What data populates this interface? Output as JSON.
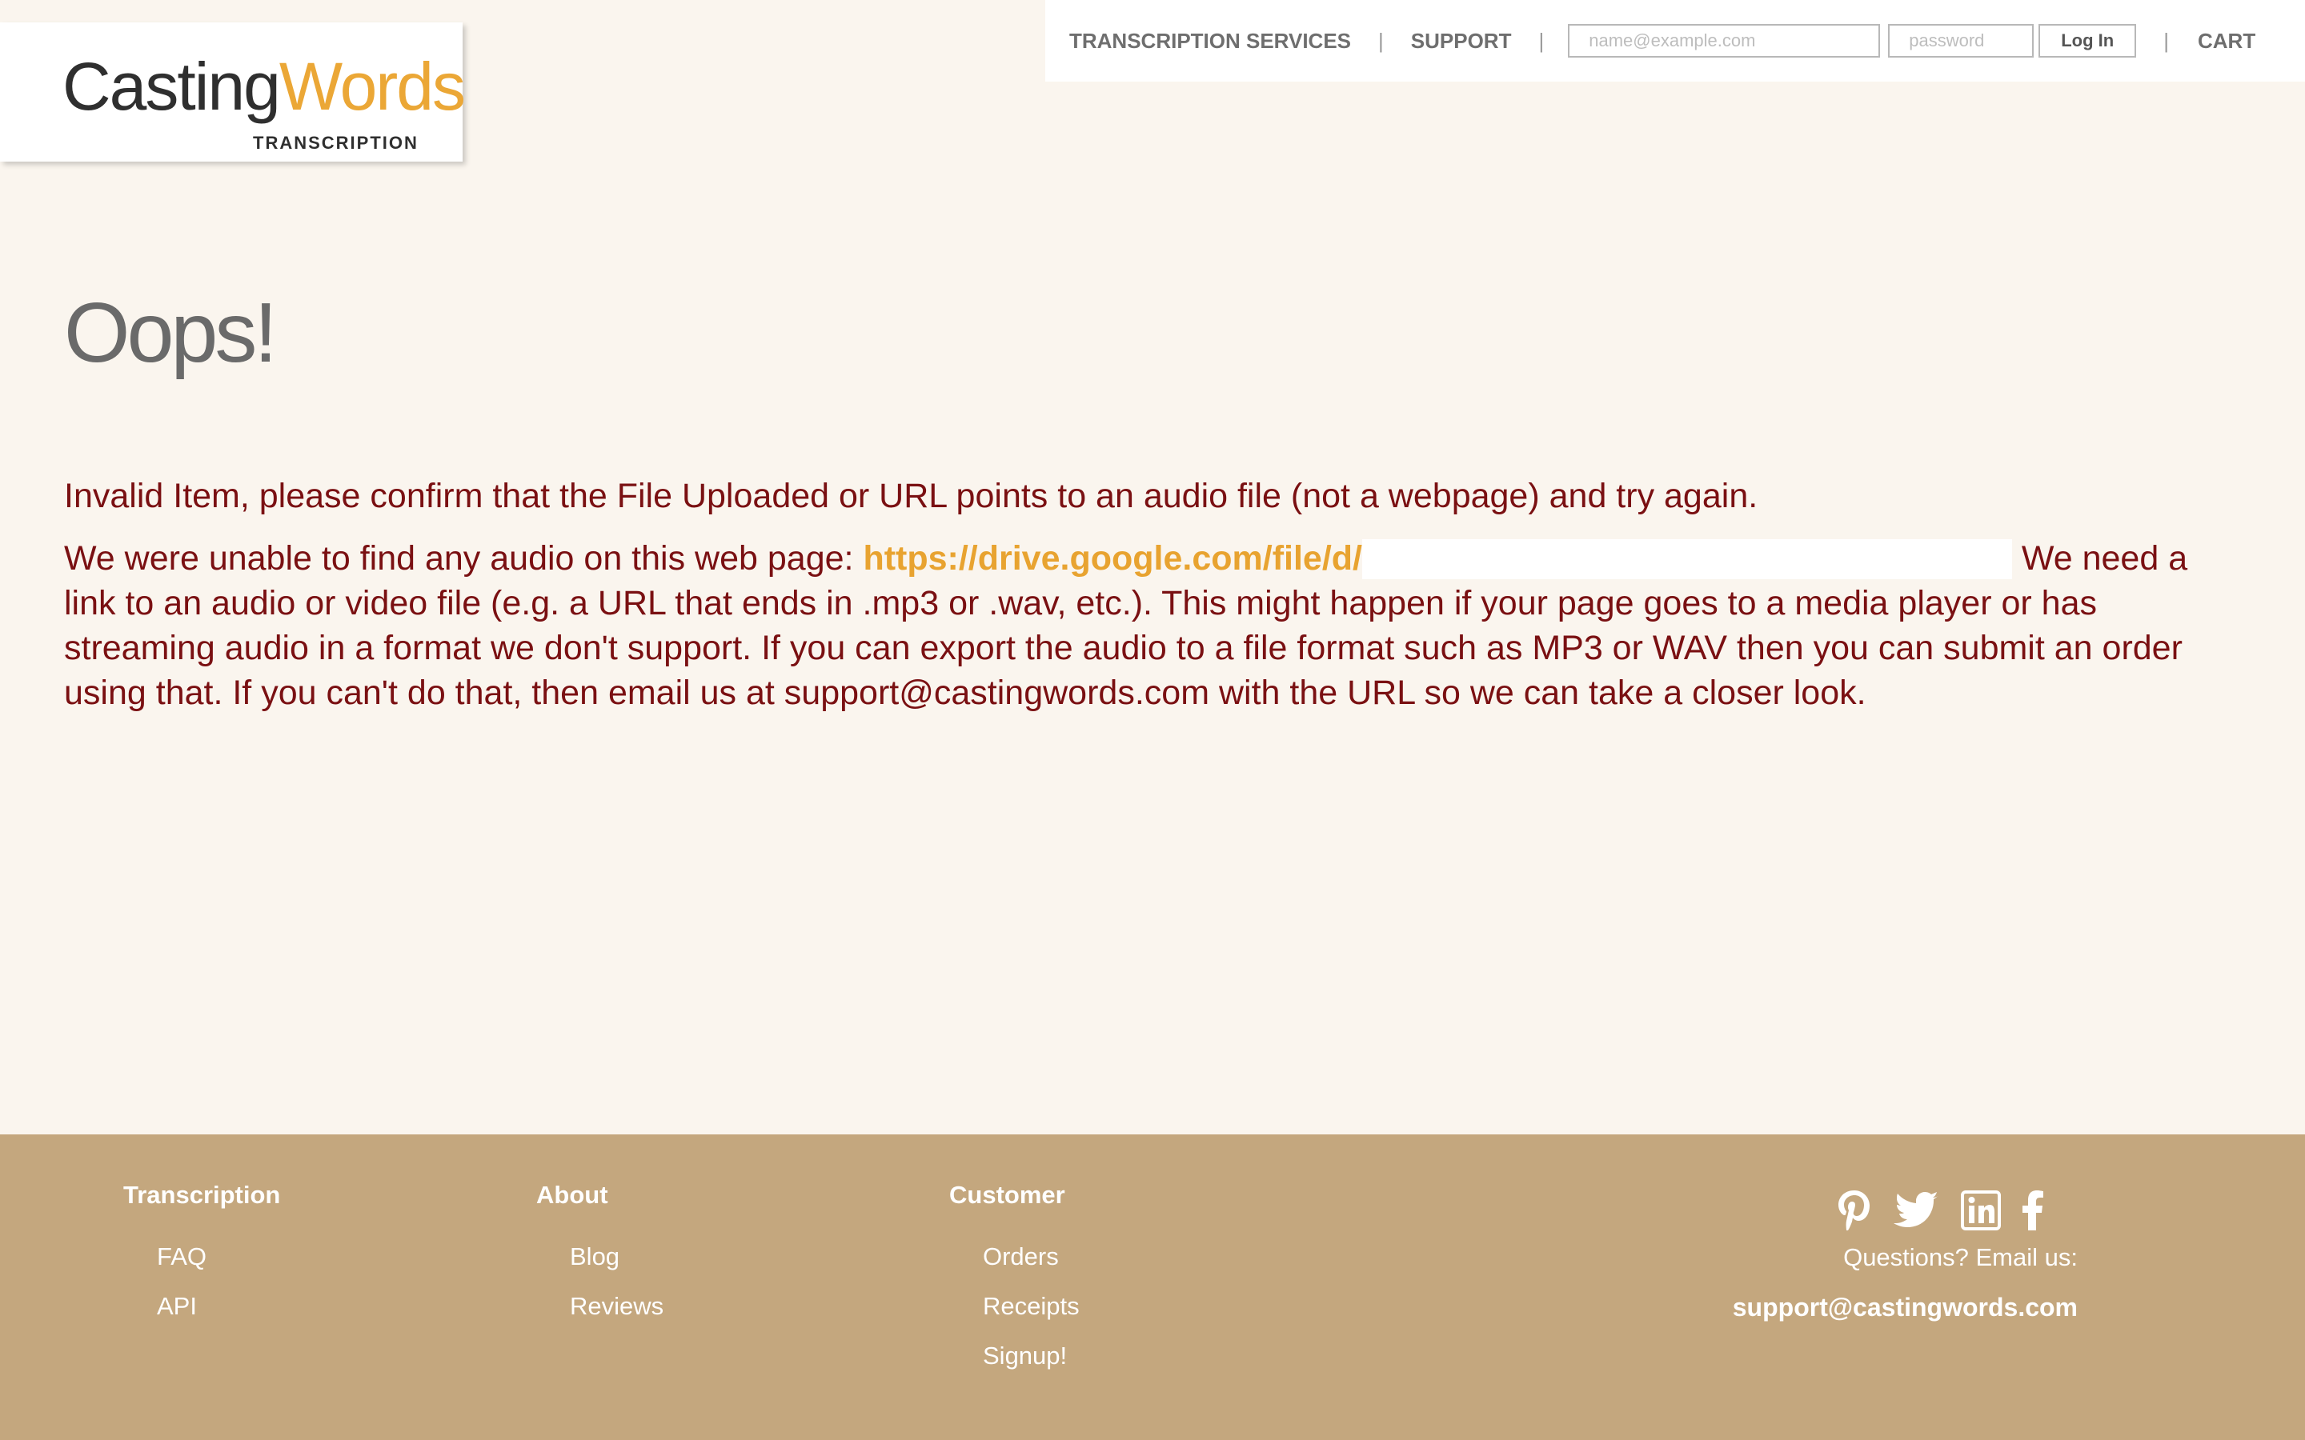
{
  "logo": {
    "part1": "Casting",
    "part2": "Words",
    "tagline": "TRANSCRIPTION",
    "colors": {
      "dark": "#2f2f2f",
      "accent": "#eba736"
    }
  },
  "nav": {
    "services": "TRANSCRIPTION SERVICES",
    "support": "SUPPORT",
    "separator": "|",
    "email_placeholder": "name@example.com",
    "password_placeholder": "password",
    "login_label": "Log In",
    "cart": "CART"
  },
  "main": {
    "heading": "Oops!",
    "message1": "Invalid Item, please confirm that the File Uploaded or URL points to an audio file (not a webpage) and try again.",
    "message2_before": "We were unable to find any audio on this web page: ",
    "url_visible": "https://drive.google.com/file/d/",
    "message2_after": " We need a link to an audio or video file (e.g. a URL that ends in .mp3 or .wav, etc.). This might happen if your page goes to a media player or has streaming audio in a format we don't support. If you can export the audio to a file format such as MP3 or WAV then you can submit an order using that. If you can't do that, then email us at support@castingwords.com with the URL so we can take a closer look.",
    "colors": {
      "message": "#7a1012",
      "link": "#e8a330",
      "heading": "#6a6a6a"
    }
  },
  "footer": {
    "columns": [
      {
        "heading": "Transcription",
        "links": [
          "FAQ",
          "API"
        ]
      },
      {
        "heading": "About",
        "links": [
          "Blog",
          "Reviews"
        ]
      },
      {
        "heading": "Customer",
        "links": [
          "Orders",
          "Receipts",
          "Signup!"
        ]
      }
    ],
    "social_icons": [
      "pinterest-icon",
      "twitter-icon",
      "linkedin-icon",
      "facebook-icon"
    ],
    "questions": "Questions? Email us:",
    "email": "support@castingwords.com",
    "background": "#c4a77e"
  }
}
